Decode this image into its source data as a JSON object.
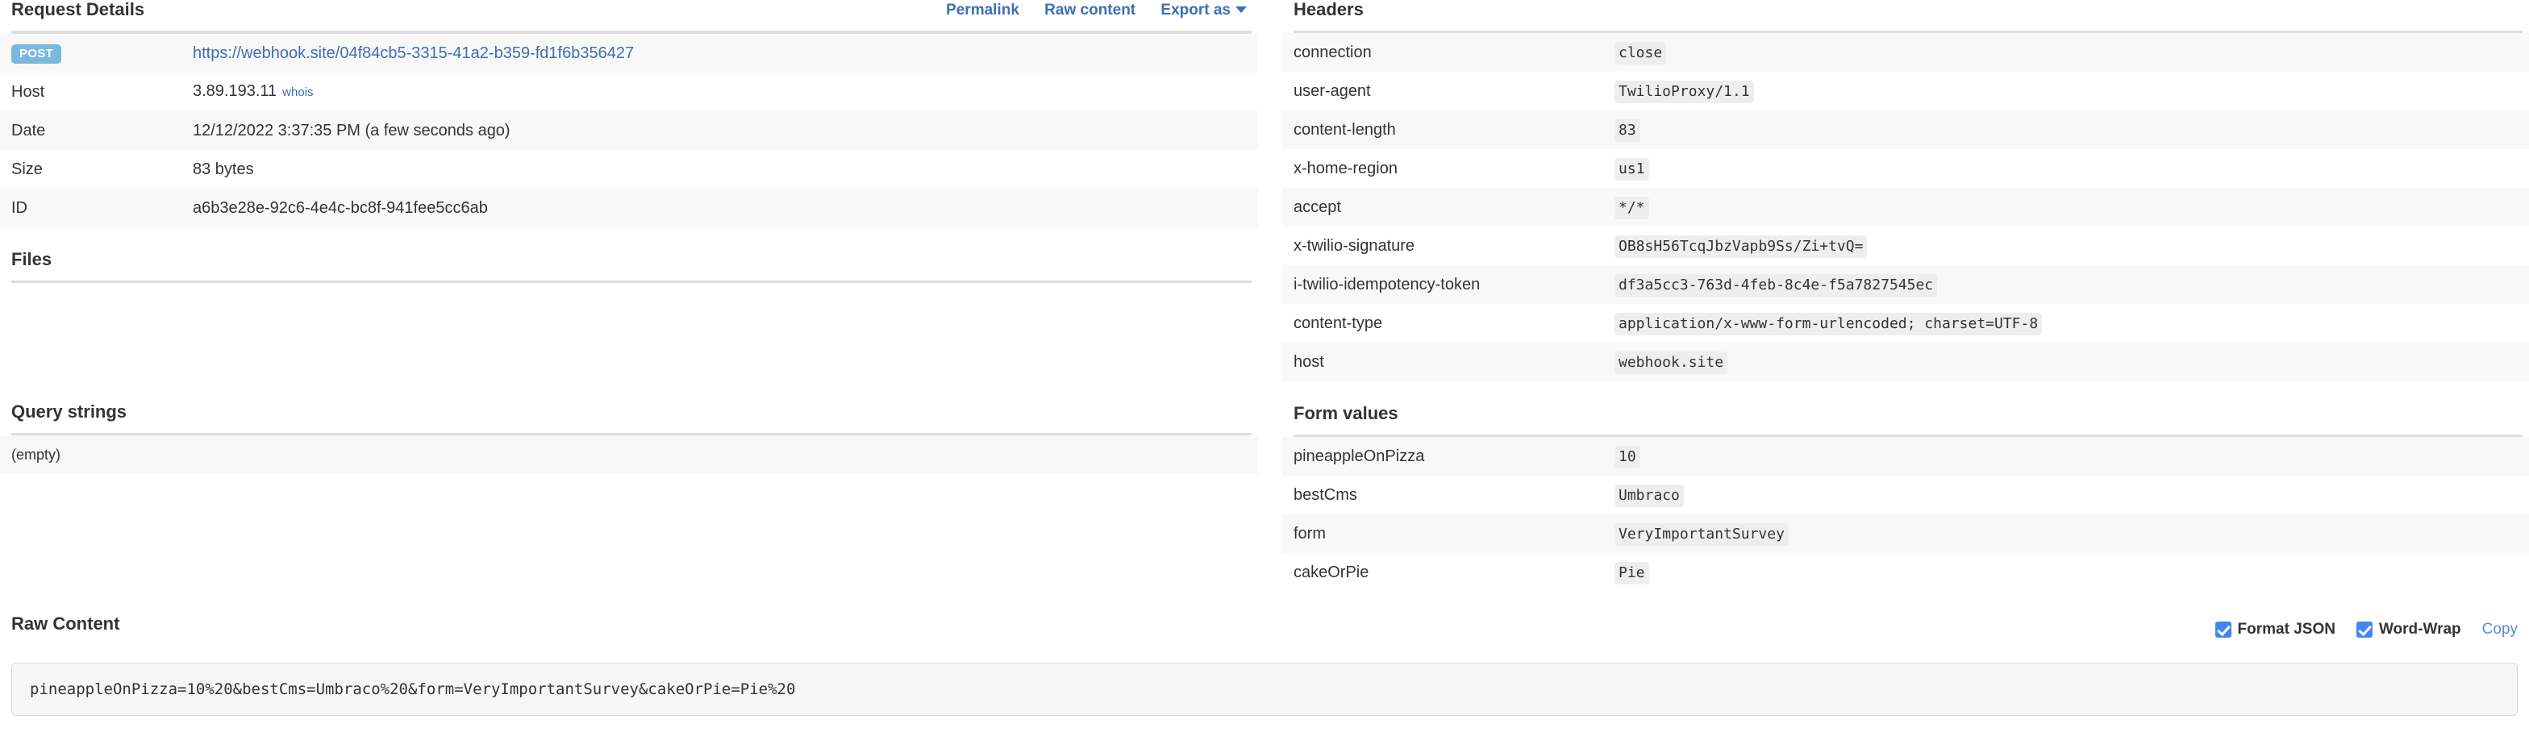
{
  "request_details": {
    "title": "Request Details",
    "actions": [
      {
        "label": "Permalink",
        "name": "permalink-link"
      },
      {
        "label": "Raw content",
        "name": "raw-content-link"
      },
      {
        "label": "Export as",
        "name": "export-as-dropdown"
      }
    ],
    "method_badge": "POST",
    "url": "https://webhook.site/04f84cb5-3315-41a2-b359-fd1f6b356427",
    "rows": [
      {
        "key": "Host",
        "value": "3.89.193.11",
        "sublink": "whois"
      },
      {
        "key": "Date",
        "value": "12/12/2022 3:37:35 PM (a few seconds ago)"
      },
      {
        "key": "Size",
        "value": "83 bytes"
      },
      {
        "key": "ID",
        "value": "a6b3e28e-92c6-4e4c-bc8f-941fee5cc6ab"
      }
    ]
  },
  "files": {
    "title": "Files"
  },
  "query_strings": {
    "title": "Query strings",
    "empty_text": "(empty)"
  },
  "headers": {
    "title": "Headers",
    "rows": [
      {
        "key": "connection",
        "value": "close"
      },
      {
        "key": "user-agent",
        "value": "TwilioProxy/1.1"
      },
      {
        "key": "content-length",
        "value": "83"
      },
      {
        "key": "x-home-region",
        "value": "us1"
      },
      {
        "key": "accept",
        "value": "*/*"
      },
      {
        "key": "x-twilio-signature",
        "value": "OB8sH56TcqJbzVapb9Ss/Zi+tvQ="
      },
      {
        "key": "i-twilio-idempotency-token",
        "value": "df3a5cc3-763d-4feb-8c4e-f5a7827545ec"
      },
      {
        "key": "content-type",
        "value": "application/x-www-form-urlencoded; charset=UTF-8"
      },
      {
        "key": "host",
        "value": "webhook.site"
      }
    ]
  },
  "form_values": {
    "title": "Form values",
    "rows": [
      {
        "key": "pineappleOnPizza",
        "value": "10"
      },
      {
        "key": "bestCms",
        "value": "Umbraco"
      },
      {
        "key": "form",
        "value": "VeryImportantSurvey"
      },
      {
        "key": "cakeOrPie",
        "value": "Pie"
      }
    ]
  },
  "raw_content": {
    "title": "Raw Content",
    "format_json_label": "Format JSON",
    "format_json_checked": true,
    "word_wrap_label": "Word-Wrap",
    "word_wrap_checked": true,
    "copy_label": "Copy",
    "body": "pineappleOnPizza=10%20&bestCms=Umbraco%20&form=VeryImportantSurvey&cakeOrPie=Pie%20"
  },
  "colors": {
    "link": "#3d6fb2",
    "badge_post_bg": "#7cb8dc",
    "checkbox_accent": "#4285f4",
    "row_stripe": "#f8f8f8",
    "rule": "#dddddd",
    "code_pill_bg": "#eeeeee"
  }
}
